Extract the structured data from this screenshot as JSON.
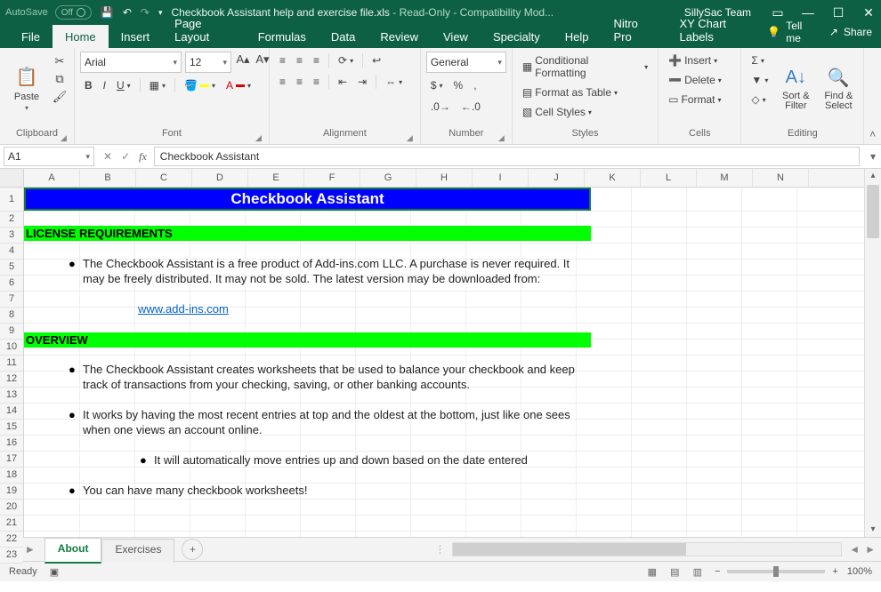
{
  "titlebar": {
    "autosave_label": "AutoSave",
    "autosave_state": "Off",
    "filename": "Checkbook Assistant help and exercise file.xls",
    "readonly": "Read-Only",
    "mode": "Compatibility Mod...",
    "team": "SillySac Team"
  },
  "menu": {
    "file": "File",
    "home": "Home",
    "insert": "Insert",
    "page_layout": "Page Layout",
    "formulas": "Formulas",
    "data": "Data",
    "review": "Review",
    "view": "View",
    "specialty": "Specialty",
    "help": "Help",
    "nitro": "Nitro Pro",
    "xychart": "XY Chart Labels",
    "tell_me": "Tell me",
    "share": "Share"
  },
  "ribbon": {
    "clipboard": {
      "paste": "Paste",
      "label": "Clipboard"
    },
    "font": {
      "name": "Arial",
      "size": "12",
      "label": "Font"
    },
    "alignment": {
      "label": "Alignment"
    },
    "number": {
      "format": "General",
      "label": "Number"
    },
    "styles": {
      "cond": "Conditional Formatting",
      "table": "Format as Table",
      "cell": "Cell Styles",
      "label": "Styles"
    },
    "cells": {
      "insert": "Insert",
      "delete": "Delete",
      "format": "Format",
      "label": "Cells"
    },
    "editing": {
      "sort": "Sort & Filter",
      "find": "Find & Select",
      "label": "Editing"
    }
  },
  "namebox": {
    "ref": "A1",
    "formula": "Checkbook Assistant"
  },
  "columns": [
    "A",
    "B",
    "C",
    "D",
    "E",
    "F",
    "G",
    "H",
    "I",
    "J",
    "K",
    "L",
    "M",
    "N"
  ],
  "rows_count": 23,
  "doc": {
    "title": "Checkbook Assistant",
    "license_hdr": "LICENSE REQUIREMENTS",
    "p1a": "The Checkbook Assistant is a free product of Add-ins.com LLC.  A purchase is never required.  It",
    "p1b": "may be freely distributed. It may not be sold.  The latest version may be downloaded from:",
    "link": "www.add-ins.com",
    "overview_hdr": "OVERVIEW",
    "p2a": "The Checkbook Assistant creates worksheets that be used to balance your checkbook and keep",
    "p2b": "track of  transactions from your checking, saving, or other banking accounts.",
    "p3a": "It works by having the most recent entries at top and the oldest at the bottom, just like one sees",
    "p3b": "when one views an account online.",
    "p4": "It will automatically move entries up and down based on the date entered",
    "p5": "You can have many checkbook worksheets!"
  },
  "sheets": {
    "about": "About",
    "exercises": "Exercises"
  },
  "status": {
    "ready": "Ready",
    "zoom": "100%"
  }
}
